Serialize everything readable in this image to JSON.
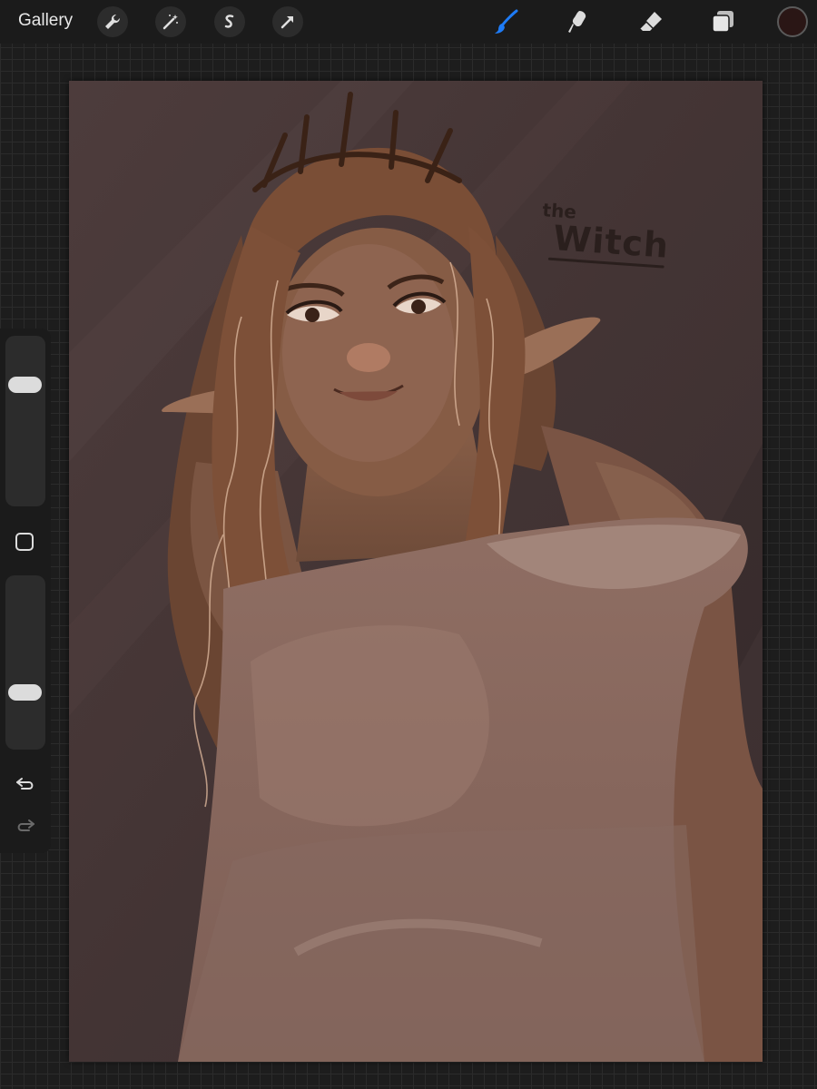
{
  "toolbar": {
    "gallery_label": "Gallery",
    "left_tools": [
      "wrench-icon",
      "magic-wand-icon",
      "selection-icon",
      "transform-arrow-icon"
    ],
    "right_tools": [
      "brush-icon",
      "smudge-icon",
      "eraser-icon",
      "layers-icon"
    ],
    "active_tool": "brush-icon",
    "accent_color": "#1e7bf5",
    "current_color": "#2a1615"
  },
  "sidebar": {
    "brush_size_level": 0.75,
    "opacity_level": 0.3,
    "buttons": [
      "modify-button",
      "undo-icon",
      "redo-icon"
    ]
  },
  "canvas": {
    "artwork_title_small": "the",
    "artwork_title_big": "Witch",
    "background_color": "#4a3b3b"
  }
}
